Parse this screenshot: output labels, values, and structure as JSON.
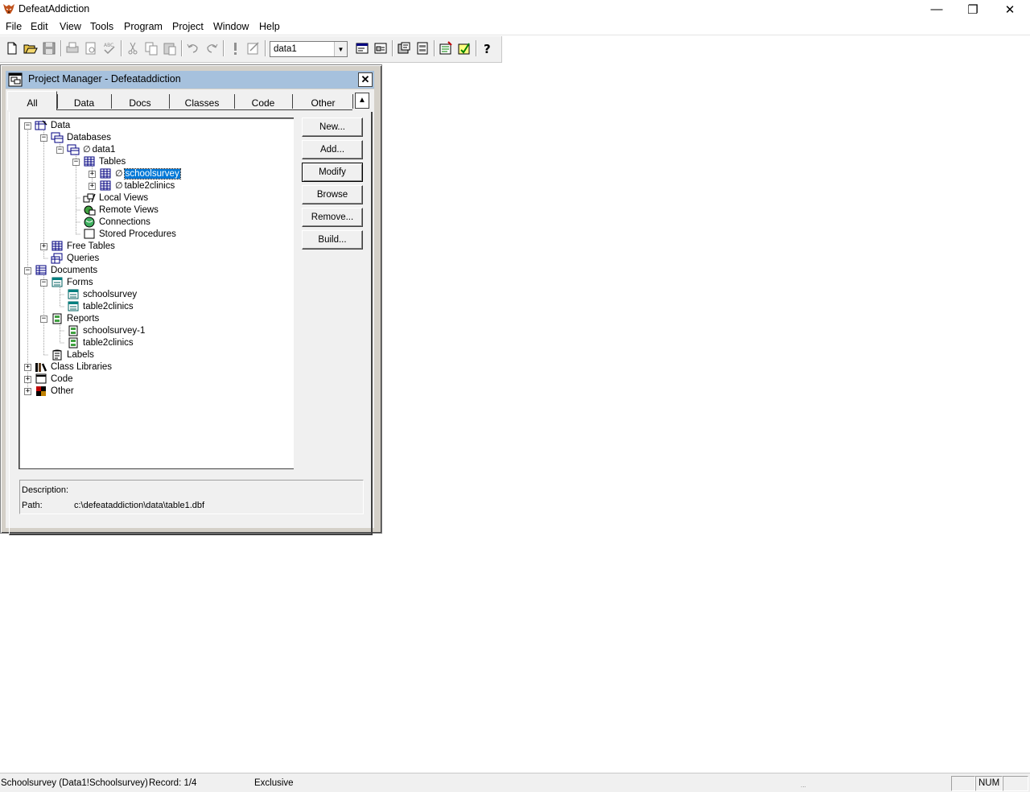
{
  "app": {
    "title": "DefeatAddiction",
    "minimize": "—",
    "maximize": "❐",
    "close": "✕"
  },
  "menu": [
    "File",
    "Edit",
    "View",
    "Tools",
    "Program",
    "Project",
    "Window",
    "Help"
  ],
  "toolbar": {
    "database_combo": "data1"
  },
  "project_manager": {
    "title": "Project Manager - Defeataddiction",
    "tabs": [
      "All",
      "Data",
      "Docs",
      "Classes",
      "Code",
      "Other"
    ],
    "active_tab": "All",
    "tree": [
      {
        "label": "Data",
        "icon": "data-icon",
        "expander": "−"
      },
      {
        "label": "Databases",
        "icon": "databases-icon",
        "expander": "−"
      },
      {
        "label": "data1",
        "icon": "database-icon",
        "expander": "−",
        "excluded": "∅"
      },
      {
        "label": "Tables",
        "icon": "tables-icon",
        "expander": "−"
      },
      {
        "label": "schoolsurvey",
        "icon": "table-icon",
        "expander": "+",
        "excluded": "∅",
        "selected": true
      },
      {
        "label": "table2clinics",
        "icon": "table-icon",
        "expander": "+",
        "excluded": "∅"
      },
      {
        "label": "Local Views",
        "icon": "local-views-icon"
      },
      {
        "label": "Remote Views",
        "icon": "remote-views-icon"
      },
      {
        "label": "Connections",
        "icon": "connections-icon"
      },
      {
        "label": "Stored Procedures",
        "icon": "stored-procedures-icon"
      },
      {
        "label": "Free Tables",
        "icon": "free-tables-icon",
        "expander": "+"
      },
      {
        "label": "Queries",
        "icon": "queries-icon"
      },
      {
        "label": "Documents",
        "icon": "documents-icon",
        "expander": "−"
      },
      {
        "label": "Forms",
        "icon": "forms-icon",
        "expander": "−"
      },
      {
        "label": "schoolsurvey",
        "icon": "form-icon"
      },
      {
        "label": "table2clinics",
        "icon": "form-icon"
      },
      {
        "label": "Reports",
        "icon": "reports-icon",
        "expander": "−"
      },
      {
        "label": "schoolsurvey-1",
        "icon": "report-icon"
      },
      {
        "label": "table2clinics",
        "icon": "report-icon"
      },
      {
        "label": "Labels",
        "icon": "labels-icon"
      },
      {
        "label": "Class Libraries",
        "icon": "class-libraries-icon",
        "expander": "+"
      },
      {
        "label": "Code",
        "icon": "code-icon",
        "expander": "+"
      },
      {
        "label": "Other",
        "icon": "other-icon",
        "expander": "+"
      }
    ],
    "buttons": [
      "New...",
      "Add...",
      "Modify",
      "Browse",
      "Remove...",
      "Build..."
    ],
    "description_label": "Description:",
    "path_label": "Path:",
    "path_value": "c:\\defeataddiction\\data\\table1.dbf"
  },
  "status": {
    "table": "Schoolsurvey (Data1!Schoolsurvey)",
    "record": "Record: 1/4",
    "mode": "Exclusive",
    "num": "NUM",
    "resize_grip": "..."
  }
}
